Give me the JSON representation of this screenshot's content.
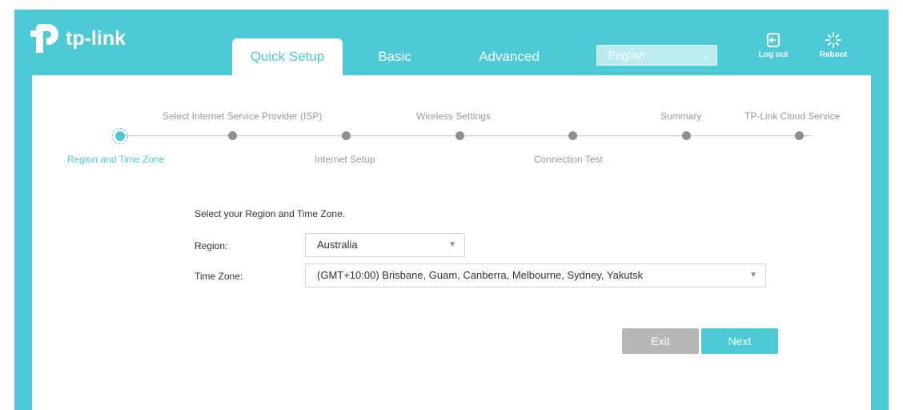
{
  "brand": {
    "logo_text": "tp-link"
  },
  "nav": {
    "tabs": [
      {
        "label": "Quick Setup",
        "active": true
      },
      {
        "label": "Basic",
        "active": false
      },
      {
        "label": "Advanced",
        "active": false
      }
    ],
    "language": "English",
    "logout_label": "Log out",
    "reboot_label": "Reboot"
  },
  "stepper": {
    "steps": [
      {
        "label": "Region and Time Zone",
        "active": true
      },
      {
        "label": "Select Internet Service Provider (ISP)",
        "active": false
      },
      {
        "label": "Internet Setup",
        "active": false
      },
      {
        "label": "Wireless Settings",
        "active": false
      },
      {
        "label": "Connection Test",
        "active": false
      },
      {
        "label": "Summary",
        "active": false
      },
      {
        "label": "TP-Link Cloud Service",
        "active": false
      }
    ]
  },
  "form": {
    "title": "Select your Region and Time Zone.",
    "region_label": "Region:",
    "region_value": "Australia",
    "timezone_label": "Time Zone:",
    "timezone_value": "(GMT+10:00) Brisbane, Guam, Canberra, Melbourne, Sydney, Yakutsk"
  },
  "actions": {
    "exit_label": "Exit",
    "next_label": "Next"
  },
  "colors": {
    "accent": "#4dcad6",
    "inactive_dot": "#8f8f8f",
    "exit_button": "#b7b7b7"
  },
  "icons": {
    "logout": "logout-icon",
    "reboot": "reboot-icon",
    "dropdown": "chevron-down-icon"
  }
}
